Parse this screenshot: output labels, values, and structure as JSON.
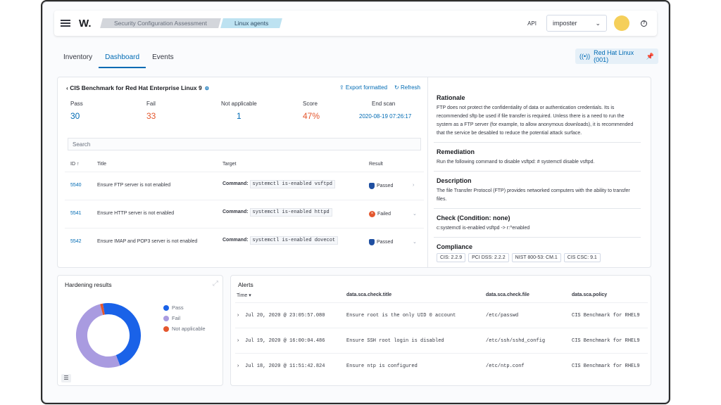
{
  "topbar": {
    "logo": "W.",
    "breadcrumbs": [
      "Security Configuration Assessment",
      "Linux agents"
    ],
    "api_label": "API",
    "api_select": "imposter",
    "help_icon": "?"
  },
  "tabs": [
    "Inventory",
    "Dashboard",
    "Events"
  ],
  "active_tab": "Dashboard",
  "agent": "Red Hat Linux (001)",
  "benchmark": {
    "title": "CIS Benchmark for Red Hat Enterprise Linux 9",
    "export": "Export formatted",
    "refresh": "Refresh",
    "stats": [
      {
        "label": "Pass",
        "value": "30",
        "color": "#006bb4"
      },
      {
        "label": "Fail",
        "value": "33",
        "color": "#e4572e"
      },
      {
        "label": "Not applicable",
        "value": "1",
        "color": "#006bb4"
      },
      {
        "label": "Score",
        "value": "47%",
        "color": "#e4572e"
      },
      {
        "label": "End scan",
        "value": "2020-08-19 07:26:17",
        "color": "#006bb4"
      }
    ],
    "search_placeholder": "Search",
    "columns": [
      "ID ↑",
      "Title",
      "Target",
      "Result"
    ],
    "command_label": "Command:",
    "rows": [
      {
        "id": "5540",
        "title": "Ensure FTP server is not enabled",
        "cmd": "systemctl is-enabled vsftpd",
        "result": "Passed"
      },
      {
        "id": "5541",
        "title": "Ensure HTTP server is not enabled",
        "cmd": "systemctl is-enabled httpd",
        "result": "Failed"
      },
      {
        "id": "5542",
        "title": "Ensure IMAP and POP3 server is not enabled",
        "cmd": "systemctl is-enabled dovecot",
        "result": "Passed"
      }
    ]
  },
  "details": {
    "rationale_title": "Rationale",
    "rationale": "FTP does not protect the confidentiality of data or authentication credentials. Its is recommended sftp be used if file transfer is required. Unless there is a need to run the system as a FTP server (for example, to allow anonymous downloads), it is recommended that the service be desabled to reduce the potential attack surface.",
    "remediation_title": "Remediation",
    "remediation": "Run the following command to disable vsftpd: # systemctl disable vsftpd.",
    "description_title": "Description",
    "description": "The file Transfer Protocol (FTP) provides networked computers with the ability to transfer files.",
    "check_title": "Check (Condition: none)",
    "check": "c:systemctl is-enabled vsftpd -> r:^enabled",
    "compliance_title": "Compliance",
    "compliance": [
      "CIS: 2.2.9",
      "PCI DSS: 2.2.2",
      "NIST 800-53: CM.1",
      "CIS CSC: 9.1"
    ]
  },
  "hardening": {
    "title": "Hardening results",
    "legend": [
      {
        "label": "Pass",
        "color": "#1a62e8"
      },
      {
        "label": "Fail",
        "color": "#a99be0"
      },
      {
        "label": "Not applicable",
        "color": "#e4572e"
      }
    ]
  },
  "chart_data": {
    "type": "pie",
    "title": "Hardening results",
    "categories": [
      "Pass",
      "Fail",
      "Not applicable"
    ],
    "values": [
      30,
      33,
      1
    ],
    "donut": true,
    "legend": "right"
  },
  "alerts": {
    "title": "Alerts",
    "columns": [
      "Time ▾",
      "data.sca.check.title",
      "data.sca.check.file",
      "data.sca.policy"
    ],
    "rows": [
      {
        "time": "Jul 20, 2020 @ 23:05:57.080",
        "title": "Ensure root is the only UID 0 account",
        "file": "/etc/passwd",
        "policy": "CIS Benchmark for RHEL9"
      },
      {
        "time": "Jul 19, 2020 @ 16:00:04.486",
        "title": "Ensure SSH root login is disabled",
        "file": "/etc/ssh/sshd_config",
        "policy": "CIS Benchmark for RHEL9"
      },
      {
        "time": "Jul 18, 2020 @ 11:51:42.824",
        "title": "Ensure ntp is configured",
        "file": "/etc/ntp.conf",
        "policy": "CIS Benchmark for RHEL9"
      }
    ]
  }
}
